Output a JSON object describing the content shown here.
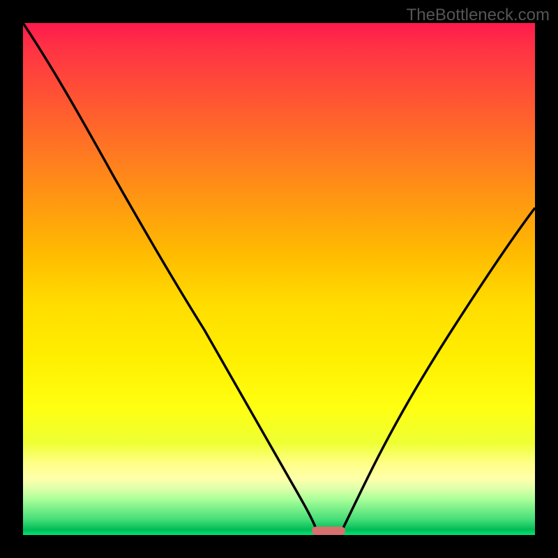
{
  "watermark": "TheBottleneck.com",
  "chart_data": {
    "type": "line",
    "title": "",
    "xlabel": "",
    "ylabel": "",
    "xlim": [
      0,
      100
    ],
    "ylim": [
      0,
      100
    ],
    "grid": false,
    "series": [
      {
        "name": "left-curve",
        "x": [
          0,
          3,
          8,
          15,
          22,
          28,
          34,
          40,
          46,
          50,
          53,
          55,
          56.5,
          57.5
        ],
        "y": [
          100,
          94,
          85,
          73,
          62,
          53,
          44,
          35,
          25,
          17,
          10,
          5,
          2,
          0
        ]
      },
      {
        "name": "right-curve",
        "x": [
          62,
          64,
          67,
          71,
          76,
          82,
          88,
          94,
          100
        ],
        "y": [
          0,
          3,
          8,
          15,
          24,
          35,
          46,
          56,
          64
        ]
      }
    ],
    "marker": {
      "x_center": 59.5,
      "y": 0,
      "width_pct": 5.5,
      "color": "#d87070"
    },
    "gradient_note": "Background gradient from red (top, high bottleneck) through orange/yellow to green (bottom, low bottleneck)"
  }
}
